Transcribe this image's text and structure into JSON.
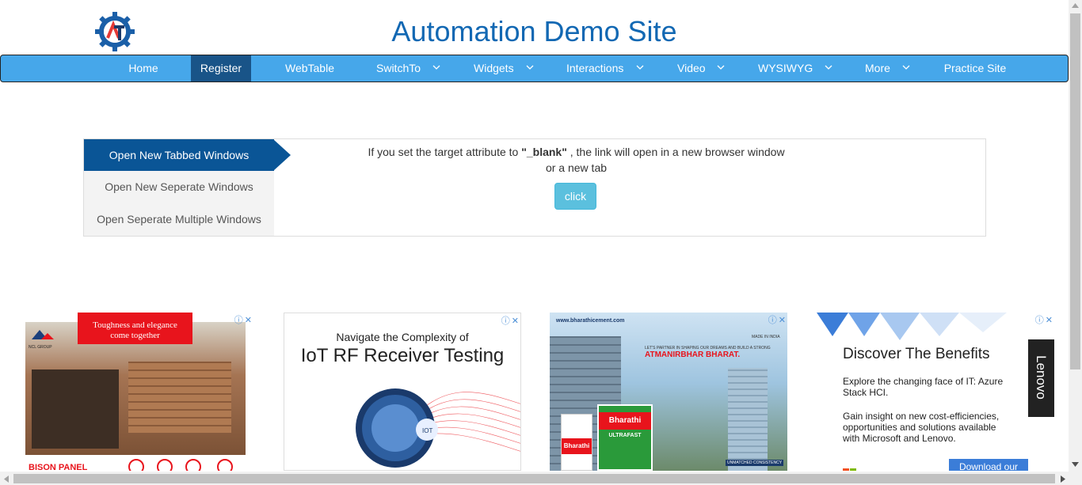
{
  "header": {
    "title": "Automation Demo Site",
    "logo_text": "AT"
  },
  "nav": {
    "items": [
      {
        "label": "Home",
        "has_caret": false
      },
      {
        "label": "Register",
        "has_caret": false,
        "active": true
      },
      {
        "label": "WebTable",
        "has_caret": false
      },
      {
        "label": "SwitchTo",
        "has_caret": true
      },
      {
        "label": "Widgets",
        "has_caret": true
      },
      {
        "label": "Interactions",
        "has_caret": true
      },
      {
        "label": "Video",
        "has_caret": true
      },
      {
        "label": "WYSIWYG",
        "has_caret": true
      },
      {
        "label": "More",
        "has_caret": true
      },
      {
        "label": "Practice Site",
        "has_caret": false
      }
    ]
  },
  "tabs": {
    "items": [
      {
        "label": "Open New Tabbed Windows",
        "active": true
      },
      {
        "label": "Open New Seperate Windows"
      },
      {
        "label": "Open Seperate Multiple Windows"
      }
    ],
    "description_before": "If you set the target attribute to ",
    "description_keyword": "\"_blank\"",
    "description_after": " , the link will open in a new browser window",
    "description_line2": "or a new tab",
    "button_label": "click"
  },
  "ads": [
    {
      "banner_text_1": "Toughness and elegance",
      "banner_text_2": "come together",
      "brand": "NCL GROUP",
      "footer_brand": "BISON PANEL"
    },
    {
      "line1": "Navigate the Complexity of",
      "line2": "IoT RF Receiver Testing",
      "icon_label": "IOT"
    },
    {
      "url": "www.bharathicement.com",
      "headline": "ATMANIRBHAR BHARAT.",
      "tagline": "LET'S PARTNER IN SHAPING OUR DREAMS AND BUILD A STRONG",
      "brand": "Bharathi",
      "product": "ULTRAFAST",
      "made_in": "MADE IN INDIA",
      "cta": "UNMATCHED CONSISTENCY"
    },
    {
      "headline": "Discover The Benefits",
      "body1": "Explore the changing face of IT: Azure Stack HCI.",
      "body2": "Gain insight on new cost-efficiencies, opportunities and solutions available with Microsoft and Lenovo.",
      "brand": "Lenovo",
      "cta": "Download our"
    }
  ],
  "colors": {
    "title": "#1268b3",
    "nav_bg": "#46a7ea",
    "nav_active": "#195488",
    "tab_active": "#0a5596",
    "button": "#5bc0de"
  }
}
